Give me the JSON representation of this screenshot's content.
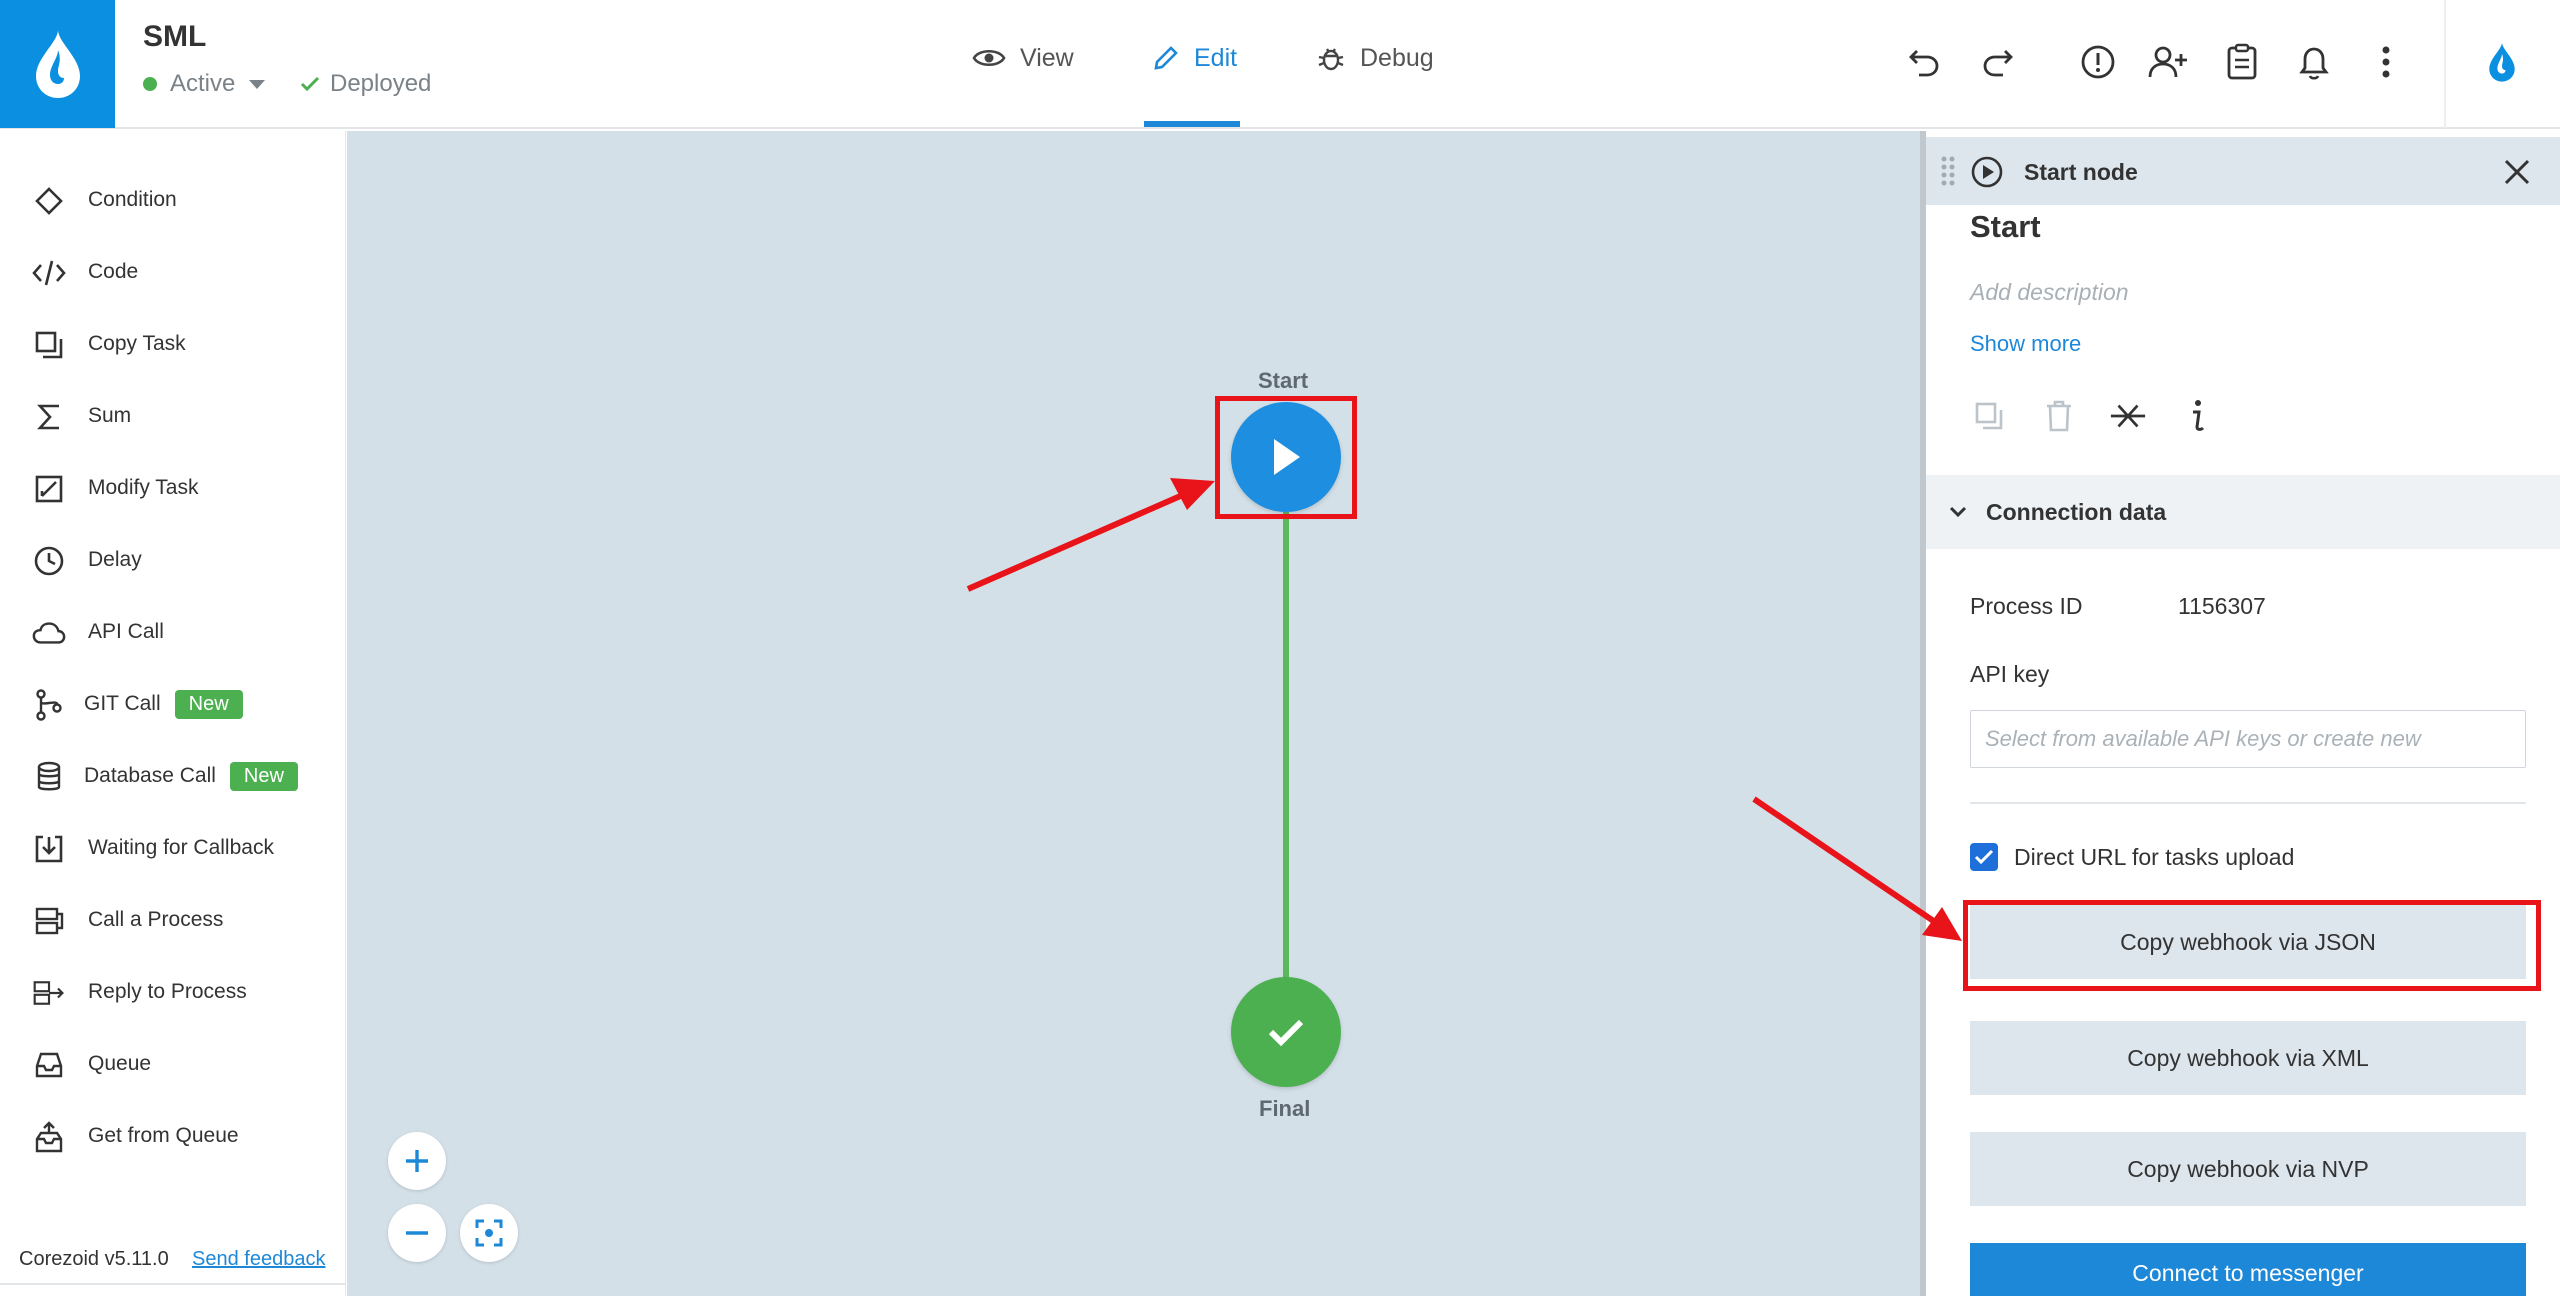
{
  "header": {
    "app_title": "SML",
    "status_label": "Active",
    "deploy_label": "Deployed",
    "tabs": [
      {
        "label": "View",
        "icon": "eye-icon"
      },
      {
        "label": "Edit",
        "icon": "pencil-icon",
        "active": true
      },
      {
        "label": "Debug",
        "icon": "bug-icon"
      }
    ],
    "toolbar_icons": [
      "undo-icon",
      "redo-icon",
      "info-icon",
      "add-user-icon",
      "clipboard-icon",
      "bell-icon",
      "more-vertical-icon",
      "drop-logo-icon"
    ]
  },
  "palette": {
    "items": [
      {
        "label": "Condition",
        "icon": "diamond-icon"
      },
      {
        "label": "Code",
        "icon": "code-icon"
      },
      {
        "label": "Copy Task",
        "icon": "copy-icon"
      },
      {
        "label": "Sum",
        "icon": "sigma-icon"
      },
      {
        "label": "Modify Task",
        "icon": "modify-icon"
      },
      {
        "label": "Delay",
        "icon": "clock-icon"
      },
      {
        "label": "API Call",
        "icon": "cloud-icon"
      },
      {
        "label": "GIT Call",
        "icon": "git-icon",
        "badge": "New"
      },
      {
        "label": "Database Call",
        "icon": "database-icon",
        "badge": "New"
      },
      {
        "label": "Waiting for Callback",
        "icon": "download-box-icon"
      },
      {
        "label": "Call a Process",
        "icon": "call-process-icon"
      },
      {
        "label": "Reply to Process",
        "icon": "reply-process-icon"
      },
      {
        "label": "Queue",
        "icon": "inbox-icon"
      },
      {
        "label": "Get from Queue",
        "icon": "get-queue-icon"
      }
    ]
  },
  "footer": {
    "version": "Corezoid v5.11.0",
    "feedback": "Send feedback"
  },
  "canvas": {
    "start_label": "Start",
    "final_label": "Final"
  },
  "panel": {
    "header_title": "Start node",
    "node_name": "Start",
    "description_placeholder": "Add description",
    "show_more": "Show more",
    "section_title": "Connection data",
    "process_id_label": "Process ID",
    "process_id_value": "1156307",
    "api_key_label": "API key",
    "api_key_placeholder": "Select from available API keys or create new",
    "direct_url_label": "Direct URL for tasks upload",
    "direct_url_checked": true,
    "btn_json": "Copy webhook via JSON",
    "btn_xml": "Copy webhook via XML",
    "btn_nvp": "Copy webhook via NVP",
    "btn_messenger": "Connect to messenger"
  },
  "colors": {
    "brand": "#0b8fe0",
    "accent": "#1e88d8",
    "success": "#4caf50",
    "annotation": "#e8141a",
    "canvas": "#d4e0e8"
  }
}
